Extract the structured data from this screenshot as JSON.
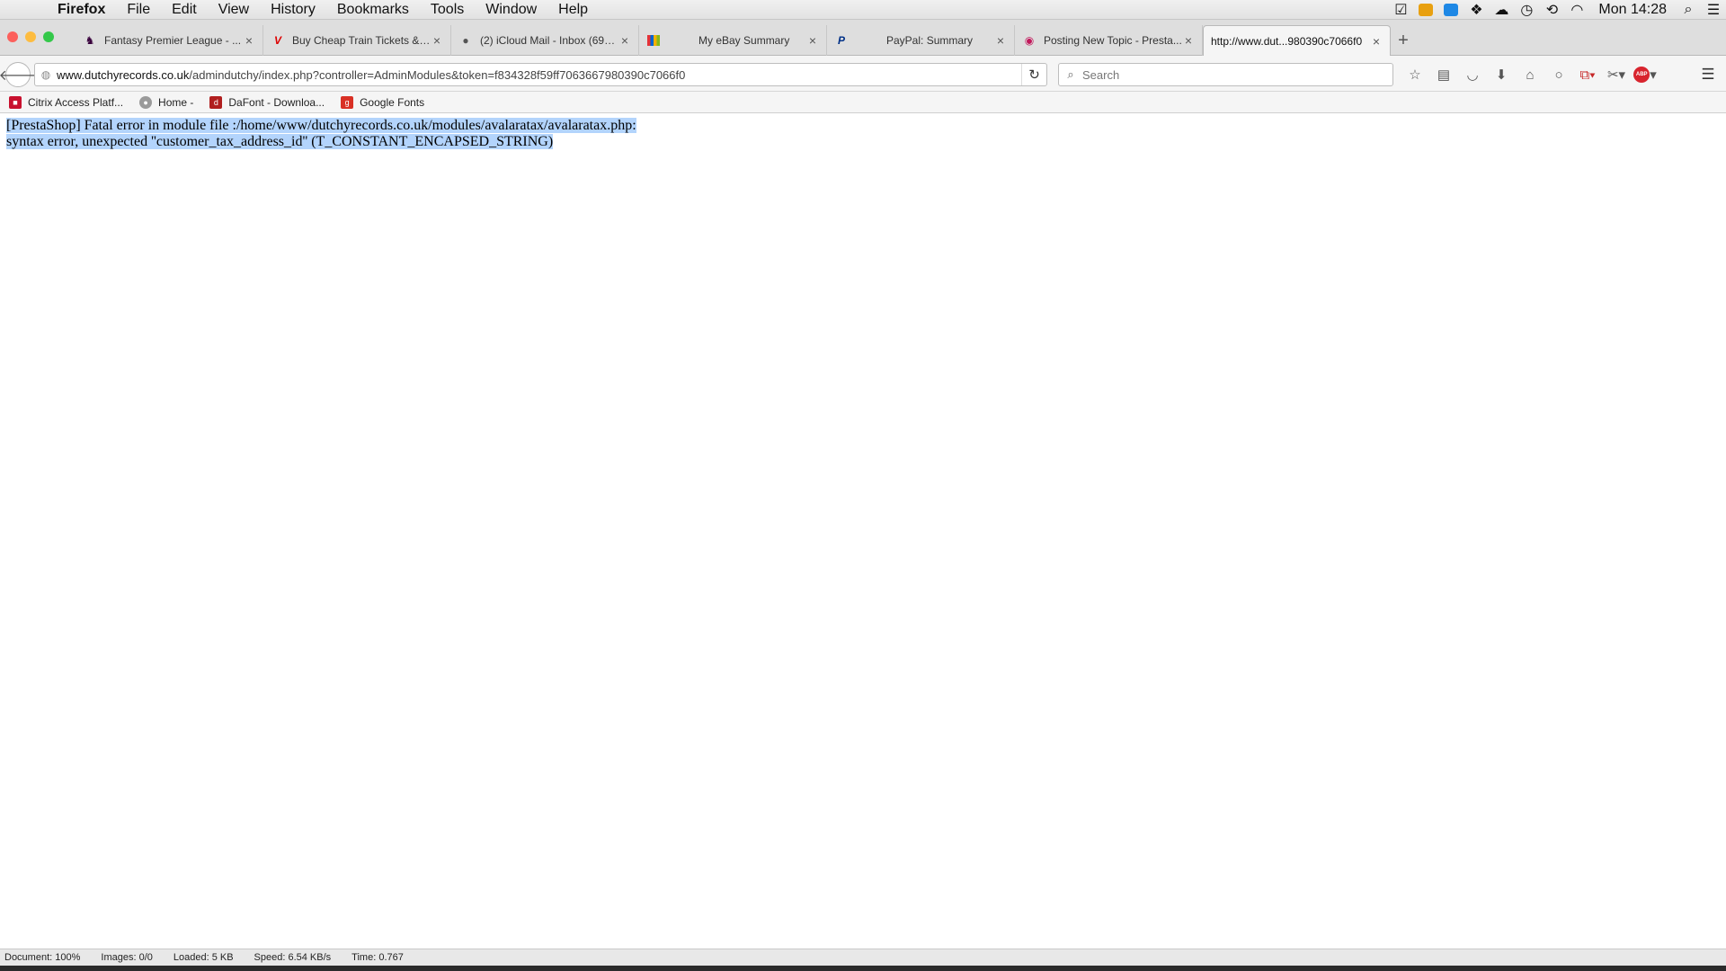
{
  "menubar": {
    "app": "Firefox",
    "items": [
      "File",
      "Edit",
      "View",
      "History",
      "Bookmarks",
      "Tools",
      "Window",
      "Help"
    ],
    "clock": "Mon 14:28"
  },
  "tabs": [
    {
      "title": "Fantasy Premier League - ...",
      "icon": "fpl-icon"
    },
    {
      "title": "Buy Cheap Train Tickets & ...",
      "icon": "virgin-icon"
    },
    {
      "title": "(2) iCloud Mail - Inbox (695...",
      "icon": "apple-icon"
    },
    {
      "title": "My eBay Summary",
      "icon": "ebay-icon"
    },
    {
      "title": "PayPal: Summary",
      "icon": "paypal-icon"
    },
    {
      "title": "Posting New Topic - Presta...",
      "icon": "prestashop-icon"
    },
    {
      "title": "http://www.dut...980390c7066f0",
      "icon": "",
      "active": true
    }
  ],
  "navbar": {
    "url_host": "www.dutchyrecords.co.uk",
    "url_path": "/admindutchy/index.php?controller=AdminModules&token=f834328f59ff7063667980390c7066f0",
    "search_placeholder": "Search"
  },
  "bookmarks": [
    {
      "label": "Citrix Access Platf...",
      "color": "#c8102e"
    },
    {
      "label": "Home -",
      "color": "#9a9a9a"
    },
    {
      "label": "DaFont - Downloa...",
      "color": "#b01e1e"
    },
    {
      "label": "Google Fonts",
      "color": "#d93025"
    }
  ],
  "content": {
    "error_line1": "[PrestaShop] Fatal error in module file :/home/www/dutchyrecords.co.uk/modules/avalaratax/avalaratax.php:",
    "error_line2": "syntax error, unexpected ''customer_tax_address_id'' (T_CONSTANT_ENCAPSED_STRING)"
  },
  "statusbar": {
    "document": "Document: 100%",
    "images": "Images: 0/0",
    "loaded": "Loaded: 5 KB",
    "speed": "Speed: 6.54 KB/s",
    "time": "Time: 0.767"
  },
  "colors": {
    "selection": "#b3d4fc",
    "close": "#fc605c",
    "minimize": "#fdbc40",
    "zoom": "#34c84a"
  }
}
